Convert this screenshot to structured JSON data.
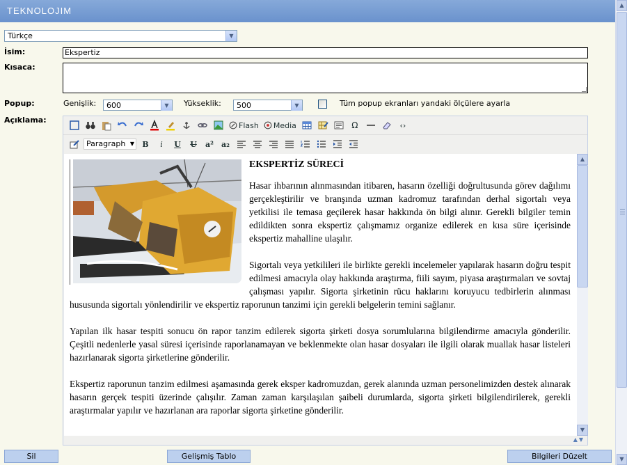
{
  "header": {
    "logo": "TEKNOLOJIM"
  },
  "language": {
    "selected": "Türkçe"
  },
  "form": {
    "name_label": "İsim:",
    "name_value": "Ekspertiz",
    "summary_label": "Kısaca:",
    "popup_label": "Popup:",
    "width_label": "Genişlik:",
    "width_value": "600",
    "height_label": "Yükseklik:",
    "height_value": "500",
    "apply_all_label": "Tüm popup ekranları yandaki ölçülere ayarla",
    "description_label": "Açıklama:"
  },
  "toolbar": {
    "flash_label": "Flash",
    "media_label": "Media",
    "paragraph_format": "Paragraph",
    "bold": "B",
    "italic": "i",
    "underline": "U",
    "strike": "U",
    "superscript": "a²",
    "subscript": "a₂"
  },
  "content": {
    "title": "EKSPERTİZ SÜRECİ",
    "paragraphs": [
      "Hasar ihbarının alınmasından itibaren, hasarın özelliği doğrultusunda görev dağılımı gerçekleştirilir ve branşında uzman kadromuz tarafından derhal sigortalı veya yetkilisi ile temasa geçilerek hasar hakkında ön bilgi alınır. Gerekli bilgiler temin edildikten sonra ekspertiz çalışmamız organize edilerek en kısa süre içerisinde ekspertiz mahalline ulaşılır.",
      "Sigortalı veya yetkilileri ile birlikte gerekli incelemeler yapılarak hasarın doğru tespit edilmesi amacıyla olay hakkında araştırma, fiili sayım, piyasa araştırmaları ve sovtaj çalışması yapılır. Sigorta şirketinin rücu haklarını koruyucu tedbirlerin alınması hususunda sigortalı yönlendirilir ve ekspertiz raporunun tanzimi için gerekli belgelerin temini sağlanır.",
      "Yapılan ilk hasar tespiti sonucu ön rapor tanzim edilerek sigorta şirketi dosya sorumlularına bilgilendirme amacıyla gönderilir. Çeşitli nedenlerle yasal süresi içerisinde raporlanamayan ve beklenmekte olan hasar dosyaları ile ilgili olarak muallak hasar listeleri hazırlanarak sigorta şirketlerine gönderilir.",
      "Ekspertiz raporunun tanzim edilmesi aşamasında gerek eksper kadromuzdan, gerek alanında uzman personelimizden destek alınarak hasarın gerçek tespiti üzerinde çalışılır. Zaman zaman karşılaşılan şaibeli durumlarda, sigorta şirketi bilgilendirilerek, gerekli araştırmalar yapılır ve hazırlanan ara raporlar sigorta şirketine gönderilir."
    ]
  },
  "buttons": {
    "delete": "Sil",
    "advanced_table": "Gelişmiş Tablo",
    "update": "Bilgileri Düzelt"
  },
  "colors": {
    "header": "#6a92cd",
    "background": "#f8f8ec",
    "button": "#bcd0ee"
  }
}
